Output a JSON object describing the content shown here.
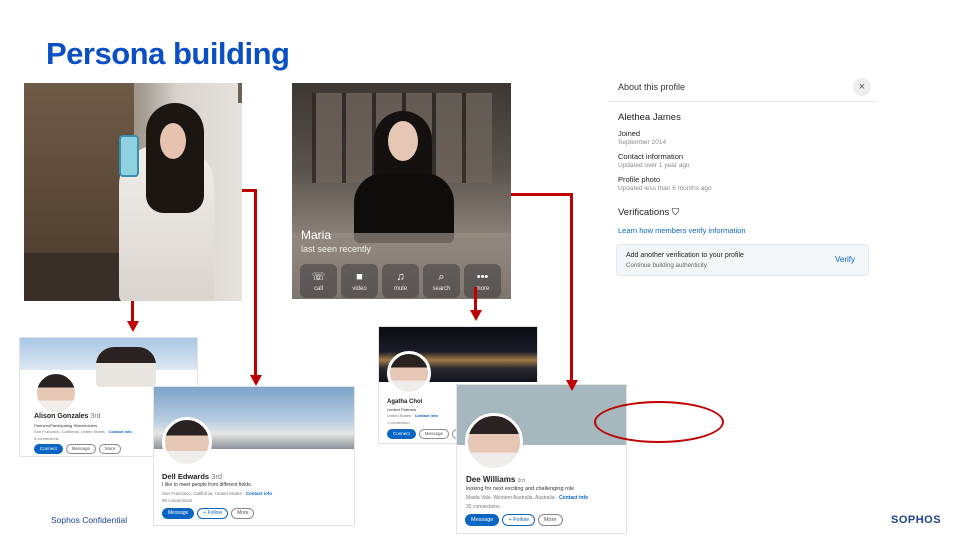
{
  "slide": {
    "title": "Persona building",
    "footer_left": "Sophos Confidential",
    "footer_logo": "SOPHOS"
  },
  "messenger": {
    "name": "Maria",
    "status": "last seen recently",
    "buttons": [
      {
        "icon": "☏",
        "label": "call"
      },
      {
        "icon": "■",
        "label": "video"
      },
      {
        "icon": "♫",
        "label": "mute"
      },
      {
        "icon": "⌕",
        "label": "search"
      },
      {
        "icon": "•••",
        "label": "more"
      }
    ]
  },
  "about": {
    "heading": "About this profile",
    "close": "×",
    "name": "Alethea James",
    "joined_label": "Joined",
    "joined_value": "September 2014",
    "contact_label": "Contact information",
    "contact_value": "Updated over 1 year ago",
    "photo_label": "Profile photo",
    "photo_value": "Updated less than 6 months ago",
    "verifications": "Verifications",
    "learn_link": "Learn how members verify information",
    "add_title": "Add another verification to your profile",
    "add_sub": "Continue building authenticity.",
    "verify_button": "Verify"
  },
  "profiles": {
    "alison": {
      "name": "Alison Gonzales",
      "degree": "3rd",
      "headline": "Partners/Participating Shareholders",
      "location": "San Francisco, California, United States",
      "contact": "Contact info",
      "connections": "6 connections",
      "connect": "Connect",
      "message": "Message",
      "more": "More"
    },
    "dell": {
      "name": "Dell Edwards",
      "degree": "3rd",
      "headline": "I like to meet people from different fields.",
      "location": "San Francisco, California, United States",
      "contact": "Contact info",
      "connections": "56 connections",
      "message": "Message",
      "follow": "+ Follow",
      "more": "More"
    },
    "agatha": {
      "name": "Agatha Choi",
      "headline": "Limited Partners",
      "location": "United States",
      "contact": "Contact info",
      "connections": "1 connection",
      "connect": "Connect",
      "message": "Message",
      "more": "M"
    },
    "dee": {
      "name": "Dee Williams",
      "degree": "3rd",
      "headline": "looking for next exciting and challenging role",
      "location": "Maida Vale, Western Australia, Australia",
      "contact": "Contact info",
      "connections": "32 connections",
      "message": "Message",
      "follow": "+ Follow",
      "more": "More"
    }
  },
  "colors": {
    "title": "#0a4fc4",
    "arrow": "#c00000",
    "linkedin_blue": "#0a66c2"
  }
}
